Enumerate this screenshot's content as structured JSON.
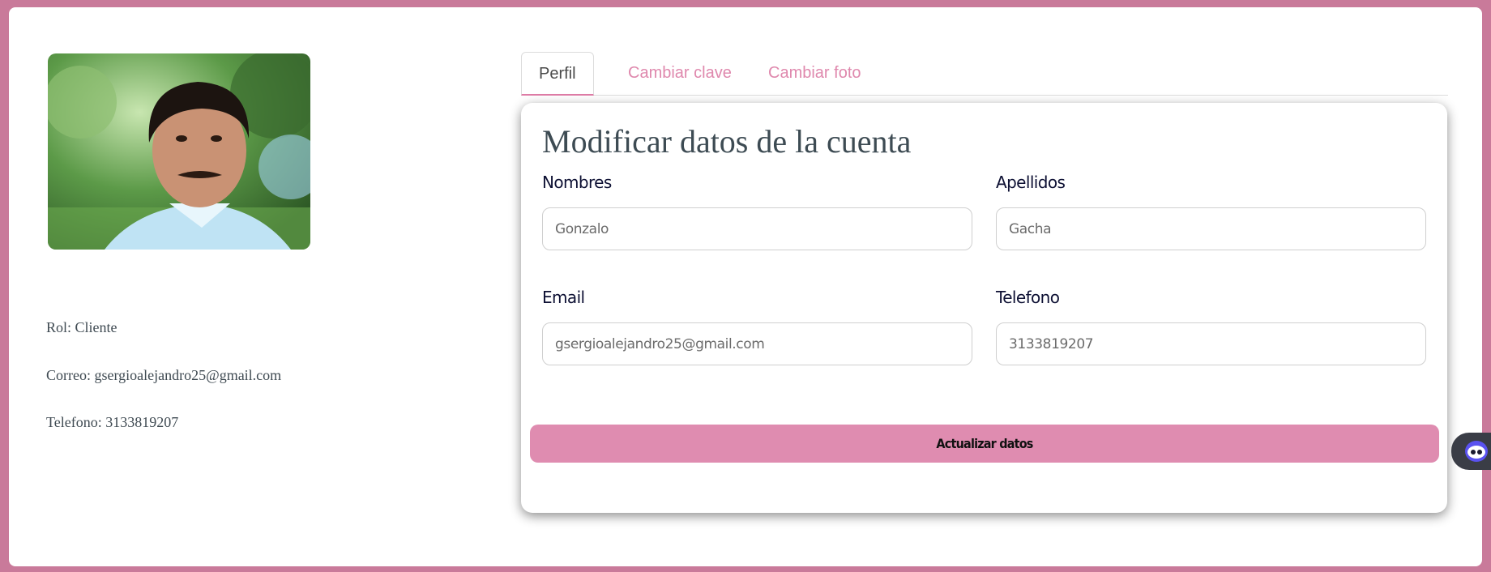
{
  "sidebar": {
    "rol_label": "Rol: ",
    "rol_value": "Cliente",
    "correo_label": "Correo: ",
    "correo_value": "gsergioalejandro25@gmail.com",
    "telefono_label": "Telefono: ",
    "telefono_value": "3133819207"
  },
  "tabs": [
    {
      "label": "Perfil",
      "active": true
    },
    {
      "label": "Cambiar clave",
      "active": false
    },
    {
      "label": "Cambiar foto",
      "active": false
    }
  ],
  "form": {
    "title": "Modificar datos de la cuenta",
    "nombres_label": "Nombres",
    "nombres_value": "Gonzalo",
    "apellidos_label": "Apellidos",
    "apellidos_value": "Gacha",
    "email_label": "Email",
    "email_value": "gsergioalejandro25@gmail.com",
    "telefono_label": "Telefono",
    "telefono_value": "3133819207",
    "submit_label": "Actualizar datos"
  },
  "icons": {
    "chat_widget": "chat-assistant-icon"
  },
  "colors": {
    "accent": "#df88ad",
    "button": "#df8cb0",
    "border": "#c97a9a"
  }
}
